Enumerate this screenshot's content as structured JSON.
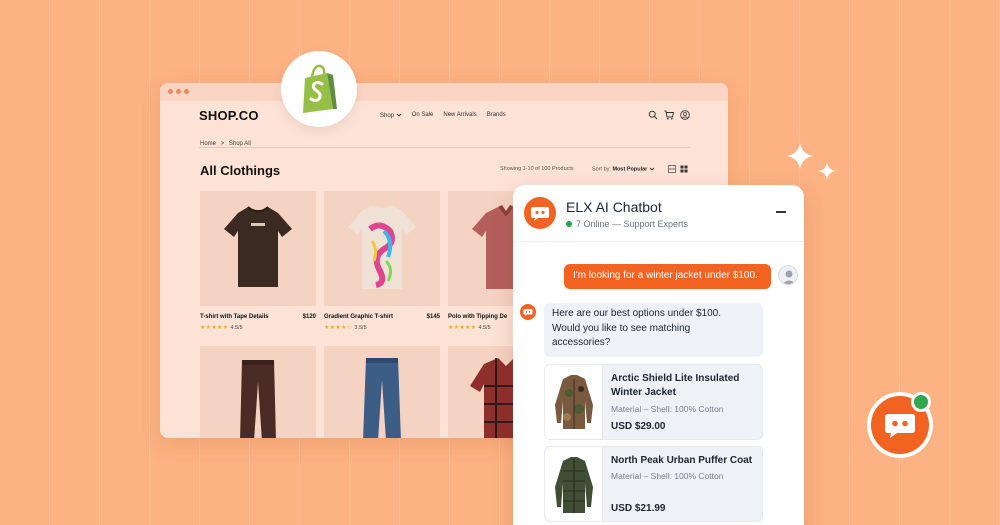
{
  "shop": {
    "logo": "SHOP.CO",
    "nav": [
      "Shop",
      "On Sale",
      "New Arrivals",
      "Brands"
    ],
    "breadcrumb": [
      "Home",
      ">",
      "Shop All"
    ],
    "title": "All Clothings",
    "results_text": "Showing 1-10 of 100 Products",
    "sort_label": "Sort by:",
    "sort_value": "Most Popular",
    "products": [
      {
        "name": "T-shirt with Tape Details",
        "price": "$120",
        "rating": "4.5/5",
        "stars": "★★★★★"
      },
      {
        "name": "Gradient Graphic T-shirt",
        "price": "$145",
        "rating": "3.5/5",
        "stars": "★★★★☆"
      },
      {
        "name": "Polo with Tipping De",
        "price": "",
        "rating": "4.5/5",
        "stars": "★★★★★"
      }
    ]
  },
  "chat": {
    "title": "ELX AI Chatbot",
    "status": "7 Online — Support Experts",
    "user_message": "I'm looking for a winter jacket under $100.",
    "bot_message_lines": [
      "Here are our best options under $100.",
      "Would you like to see matching",
      "accessories?"
    ],
    "products": [
      {
        "name": "Arctic Shield Lite Insulated Winter Jacket",
        "material": "Material – Shell: 100% Cotton",
        "price": "USD $29.00"
      },
      {
        "name": "North Peak Urban Puffer Coat",
        "material": "Material – Shell: 100% Cotton",
        "price": "USD $21.99"
      }
    ]
  },
  "colors": {
    "background": "#fdb283",
    "accent": "#f26322",
    "shopify_green": "#95bf47",
    "online": "#22a447"
  },
  "icons": [
    "shopify-logo-icon",
    "search-icon",
    "cart-icon",
    "user-icon",
    "chevron-down-icon",
    "grid-view-icon",
    "list-view-icon",
    "chatbot-icon",
    "minimize-icon",
    "user-avatar-icon",
    "sparkle-icon"
  ]
}
